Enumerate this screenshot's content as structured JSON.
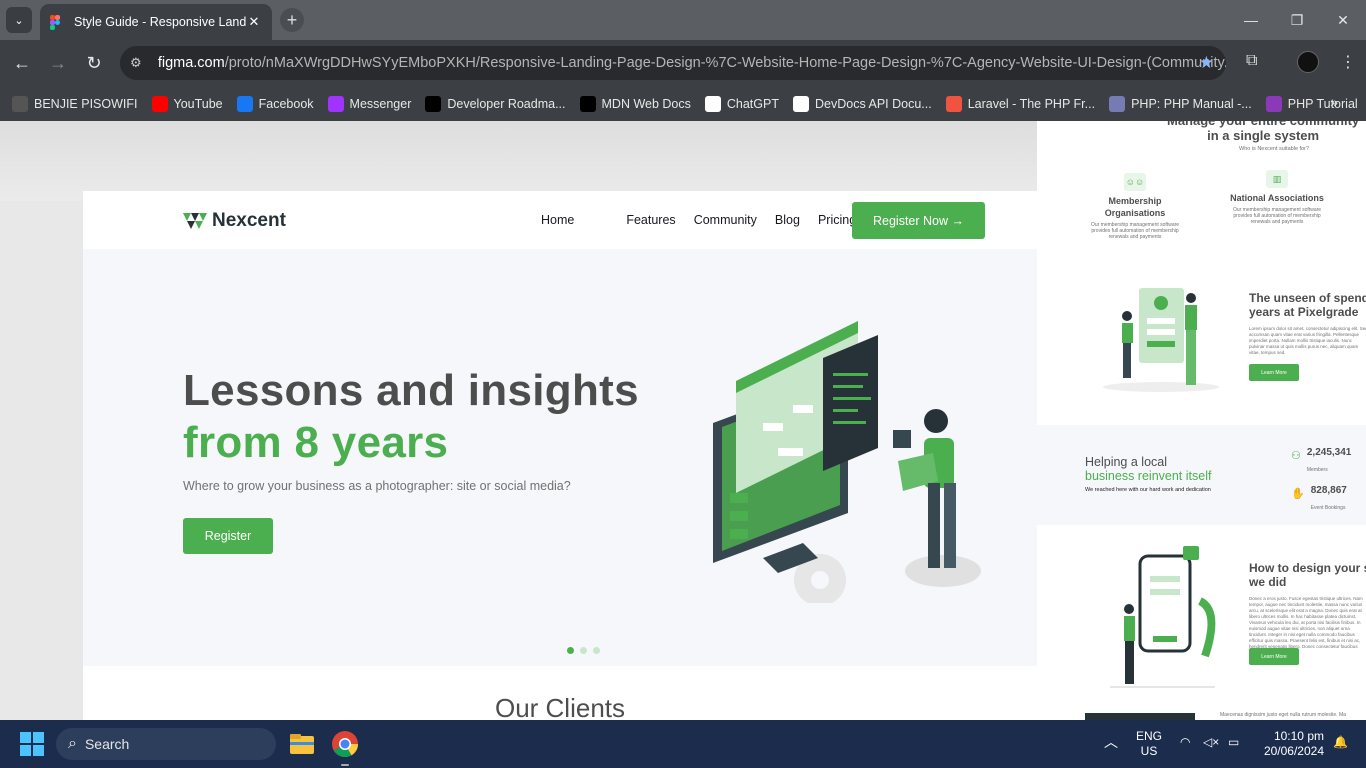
{
  "browser": {
    "tab_title": "Style Guide - Responsive Landin",
    "url_host": "figma.com",
    "url_path": "/proto/nMaXWrgDDHwSYyEMboPXKH/Responsive-Landing-Page-Design-%7C-Website-Home-Page-Design-%7C-Agency-Website-UI-Design-(Community..."
  },
  "bookmarks": [
    {
      "label": "BENJIE PISOWIFI",
      "color": "#555"
    },
    {
      "label": "YouTube",
      "color": "#ff0000"
    },
    {
      "label": "Facebook",
      "color": "#1877f2"
    },
    {
      "label": "Messenger",
      "color": "#a033ff"
    },
    {
      "label": "Developer Roadma...",
      "color": "#000"
    },
    {
      "label": "MDN Web Docs",
      "color": "#000"
    },
    {
      "label": "ChatGPT",
      "color": "#fff"
    },
    {
      "label": "DevDocs API Docu...",
      "color": "#fff"
    },
    {
      "label": "Laravel - The PHP Fr...",
      "color": "#f05340"
    },
    {
      "label": "PHP: PHP Manual -...",
      "color": "#777bb3"
    },
    {
      "label": "PHP Tutorial",
      "color": "#8a3ab9"
    }
  ],
  "site": {
    "brand": "Nexcent",
    "nav": [
      "Home",
      "Features",
      "Community",
      "Blog",
      "Pricing"
    ],
    "register_now": "Register Now →",
    "hero_line1": "Lessons and insights",
    "hero_line2": "from 8 years",
    "hero_sub": "Where to grow your business as a photographer: site or social media?",
    "hero_btn": "Register",
    "clients_heading": "Our Clients",
    "accent": "#4caf4f"
  },
  "panel": {
    "title": "Manage your entire community\nin a single system",
    "subtitle": "Who is Nexcent suitable for?",
    "card1_title": "Membership Organisations",
    "card1_text": "Our membership management software provides full automation of membership renewals and payments",
    "card2_title": "National Associations",
    "card2_text": "Our membership management software provides full automation of membership renewals and payments",
    "sec1_title": "The unseen of spend\nyears at Pixelgrade",
    "sec1_text": "Lorem ipsum dolor sit amet, consectetur adipiscing elit. Sed accumsan quam vitae erat varius fringilla. Pellentesque imperdiet porta. Nullam mollis tristique iaculis. Nunc pulvinar massa ut quis mollis purus nec, aliquam quam vitae, tempus sed.",
    "learn_more": "Learn More",
    "stats_title1": "Helping a local",
    "stats_title2": "business reinvent itself",
    "stats_sub": "We reached here with our hard work and dedication",
    "members_value": "2,245,341",
    "members_label": "Members",
    "bookings_value": "828,867",
    "bookings_label": "Event Bookings",
    "sec2_title": "How to design your s\nwe did",
    "sec2_text": "Donec a eros justo. Fusce egestas tristique ultrices. Nam tempor, augue nec tincidunt molestie, massa nunc varius arcu, at scelerisque elit erat a magna. Donec quis erat at libero ultrices mollis. In hac habitasse platea dictumst. Vivamus vehicula leo dui, at porta nisi facilisis finibus. In euismod augue vitae nisi ultricies, non aliquet urna tincidunt. Integer in nisi eget nulla commodo faucibus efficitur quis massa. Praesent felis est, finibus et nisi ac, hendrerit venenatis libero. Donec consectetur faucibus ipsum id gravida.",
    "bottom_text": "Maecenas dignissim justo eget nulla rutrum molestie. Ma"
  },
  "taskbar": {
    "search_placeholder": "Search",
    "lang1": "ENG",
    "lang2": "US",
    "time": "10:10 pm",
    "date": "20/06/2024"
  }
}
